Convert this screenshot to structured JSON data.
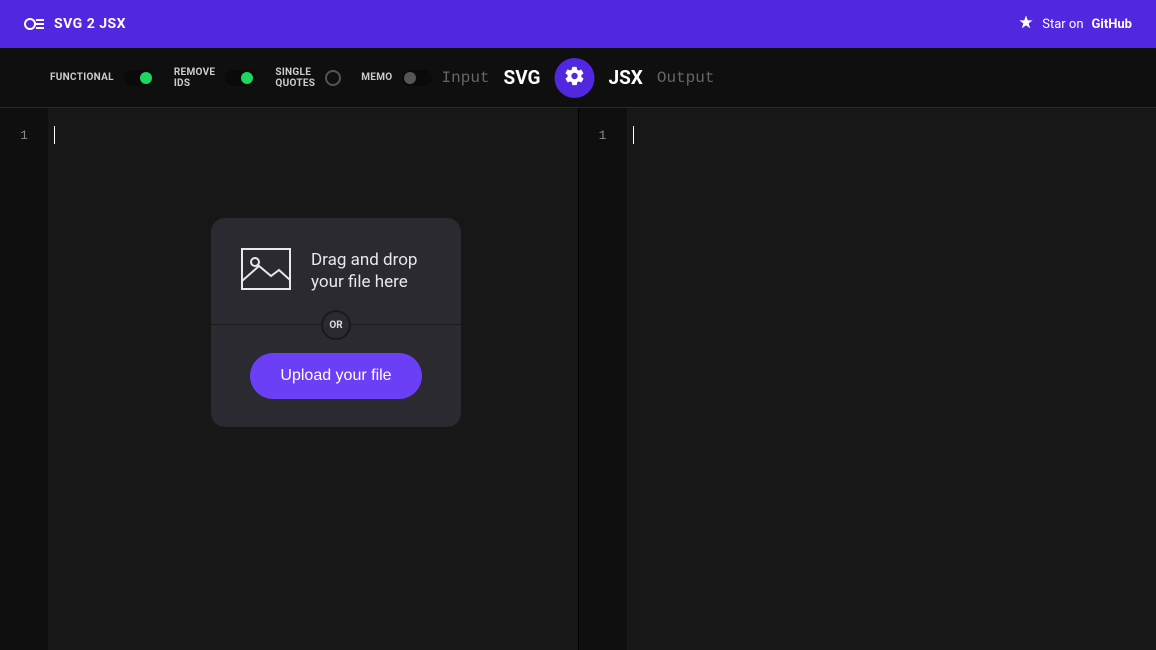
{
  "header": {
    "logo_text": "SVG 2 JSX",
    "star_text": "Star on",
    "github_text": "GitHub"
  },
  "toolbar": {
    "toggles": {
      "functional": {
        "label": "FUNCTIONAL",
        "state": "on"
      },
      "remove_ids": {
        "label": "REMOVE\nIDS",
        "state": "on"
      },
      "single_quotes": {
        "label": "SINGLE\nQUOTES",
        "state": "off-circle"
      },
      "memo": {
        "label": "MEMO",
        "state": "off"
      }
    },
    "input_hint": "Input",
    "input_title": "SVG",
    "output_title": "JSX",
    "output_hint": "Output"
  },
  "editor": {
    "left_line_number": "1",
    "right_line_number": "1"
  },
  "drop": {
    "message": "Drag and drop your file here",
    "or_label": "OR",
    "upload_label": "Upload your file"
  }
}
